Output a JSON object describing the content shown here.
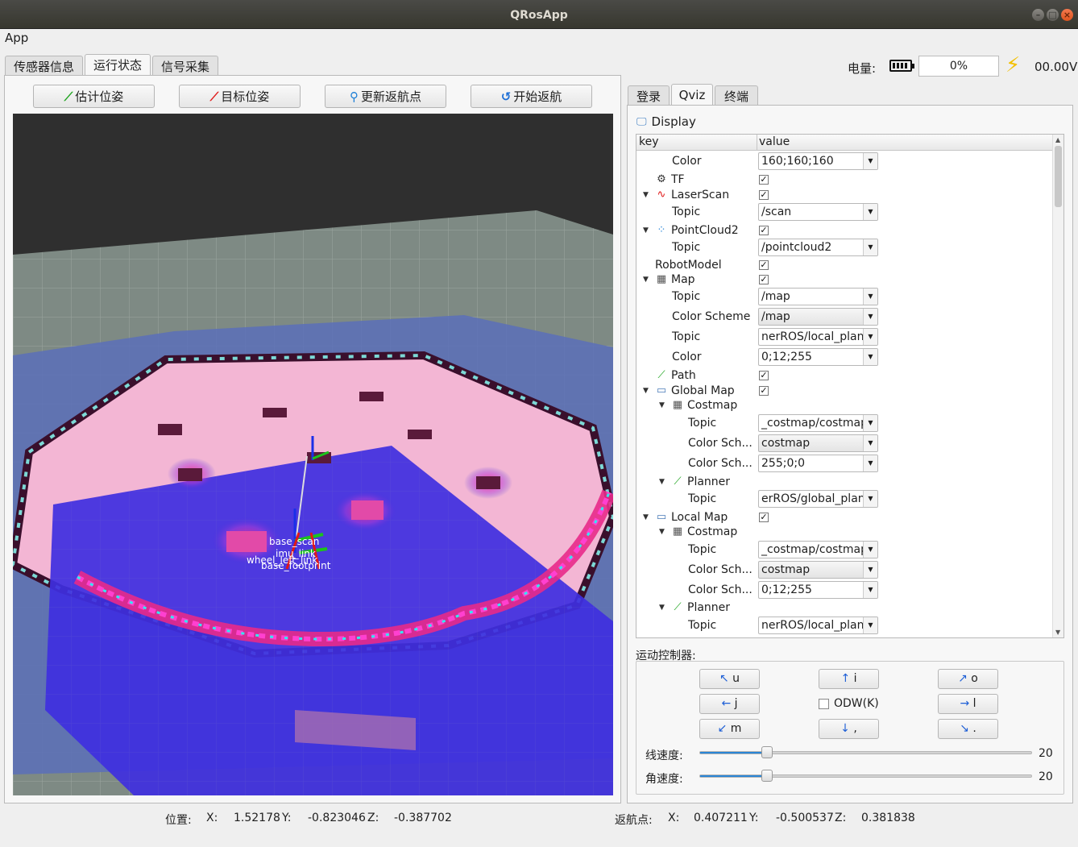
{
  "window": {
    "title": "QRosApp"
  },
  "menu": {
    "app": "App"
  },
  "main_tabs": [
    "传感器信息",
    "运行状态",
    "信号采集"
  ],
  "battery": {
    "label": "电量:",
    "percent": "0%",
    "voltage": "00.00V"
  },
  "toolbar": {
    "estimate": "估计位姿",
    "goal": "目标位姿",
    "update_return": "更新返航点",
    "start_return": "开始返航"
  },
  "side_tabs": [
    "登录",
    "Qviz",
    "终端"
  ],
  "display": {
    "header": "Display",
    "col_key": "key",
    "col_value": "value"
  },
  "tree": [
    {
      "key": "Color",
      "value": "160;160;160",
      "type": "combo",
      "indent": 1
    },
    {
      "key": "TF",
      "type": "check",
      "indent": 0,
      "icon": "tf-icon"
    },
    {
      "key": "LaserScan",
      "type": "check",
      "indent": 0,
      "icon": "laserscan-icon",
      "expanded": true
    },
    {
      "key": "Topic",
      "value": "/scan",
      "type": "combo",
      "indent": 1
    },
    {
      "key": "PointCloud2",
      "type": "check",
      "indent": 0,
      "icon": "pointcloud-icon",
      "expanded": true
    },
    {
      "key": "Topic",
      "value": "/pointcloud2",
      "type": "combo",
      "indent": 1
    },
    {
      "key": "RobotModel",
      "type": "check",
      "indent": -1
    },
    {
      "key": "Map",
      "type": "check",
      "indent": 0,
      "icon": "map-icon",
      "expanded": true
    },
    {
      "key": "Topic",
      "value": "/map",
      "type": "combo",
      "indent": 1
    },
    {
      "key": "Color Scheme",
      "value": "/map",
      "type": "combo-gray",
      "indent": 1
    },
    {
      "key": "Topic",
      "value": "nerROS/local_plan",
      "type": "combo",
      "indent": 1
    },
    {
      "key": "Color",
      "value": "0;12;255",
      "type": "combo",
      "indent": 1
    },
    {
      "key": "Path",
      "type": "check",
      "indent": 0,
      "icon": "path-icon"
    },
    {
      "key": "Global Map",
      "type": "check",
      "indent": 0,
      "icon": "folder-icon",
      "expanded": true
    },
    {
      "key": "Costmap",
      "type": "none",
      "indent": 1,
      "icon": "map-icon",
      "expanded": true
    },
    {
      "key": "Topic",
      "value": "_costmap/costmap",
      "type": "combo",
      "indent": 2
    },
    {
      "key": "Color Sch...",
      "value": "costmap",
      "type": "combo-gray",
      "indent": 2
    },
    {
      "key": "Color Sch...",
      "value": "255;0;0",
      "type": "combo",
      "indent": 2
    },
    {
      "key": "Planner",
      "type": "none",
      "indent": 1,
      "icon": "path-icon",
      "expanded": true
    },
    {
      "key": "Topic",
      "value": "erROS/global_plan",
      "type": "combo",
      "indent": 2
    },
    {
      "key": "Local Map",
      "type": "check",
      "indent": 0,
      "icon": "folder-icon",
      "expanded": true
    },
    {
      "key": "Costmap",
      "type": "none",
      "indent": 1,
      "icon": "map-icon",
      "expanded": true
    },
    {
      "key": "Topic",
      "value": "_costmap/costmap",
      "type": "combo",
      "indent": 2
    },
    {
      "key": "Color Sch...",
      "value": "costmap",
      "type": "combo-gray",
      "indent": 2
    },
    {
      "key": "Color Sch...",
      "value": "0;12;255",
      "type": "combo",
      "indent": 2
    },
    {
      "key": "Planner",
      "type": "none",
      "indent": 1,
      "icon": "path-icon",
      "expanded": true
    },
    {
      "key": "Topic",
      "value": "nerROS/local_plan",
      "type": "combo",
      "indent": 2
    }
  ],
  "motion": {
    "title": "运动控制器:",
    "keys": {
      "u": "u",
      "i": "i",
      "o": "o",
      "j": "j",
      "l": "l",
      "m": "m",
      "comma": ",",
      "period": "."
    },
    "odw": "ODW(K)",
    "linear_label": "线速度:",
    "linear_value": "20",
    "linear_fraction": 0.2,
    "angular_label": "角速度:",
    "angular_value": "20",
    "angular_fraction": 0.2
  },
  "scene": {
    "labels": {
      "a": "base_scan",
      "b": "imu_link",
      "c": "wheel_left_link",
      "d": "base_footprint"
    }
  },
  "status": {
    "pos_label": "位置:",
    "x_label": "X:",
    "x": "1.52178",
    "y_label": "Y:",
    "y": "-0.823046",
    "z_label": "Z:",
    "z": "-0.387702",
    "ret_label": "返航点:",
    "rx_label": "X:",
    "rx": "0.407211",
    "ry_label": "Y:",
    "ry": "-0.500537",
    "rz_label": "Z:",
    "rz": "0.381838"
  }
}
